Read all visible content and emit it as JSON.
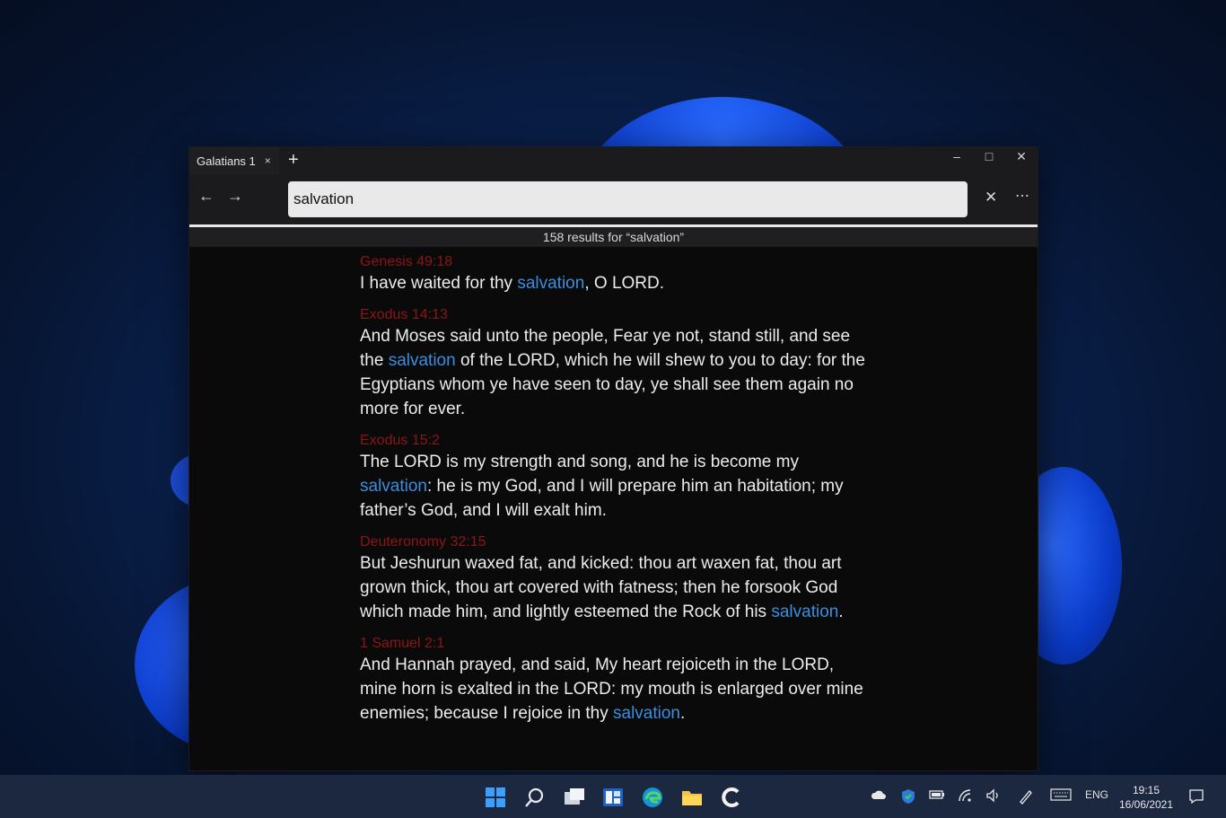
{
  "window": {
    "tab_title": "Galatians 1",
    "tab_close_glyph": "×",
    "new_tab_glyph": "+",
    "minimize_glyph": "–",
    "maximize_glyph": "□",
    "close_glyph": "✕"
  },
  "toolbar": {
    "back_glyph": "←",
    "forward_glyph": "→",
    "search_value": "salvation",
    "clear_glyph": "✕",
    "more_glyph": "⋯"
  },
  "results_summary": "158 results for “salvation”",
  "results": [
    {
      "ref": "Genesis 49:18",
      "parts": [
        "I have waited for thy ",
        "salvation",
        ", O LORD."
      ]
    },
    {
      "ref": "Exodus 14:13",
      "parts": [
        "And Moses said unto the people, Fear ye not, stand still, and see the ",
        "salvation",
        " of the LORD, which he will shew to you to day: for the Egyptians whom ye have seen to day, ye shall see them again no more for ever."
      ]
    },
    {
      "ref": "Exodus 15:2",
      "parts": [
        "The LORD is my strength and song, and he is become my ",
        "salvation",
        ": he is my God, and I will prepare him an habitation; my father’s God, and I will exalt him."
      ]
    },
    {
      "ref": "Deuteronomy 32:15",
      "parts": [
        "But Jeshurun waxed fat, and kicked: thou art waxen fat, thou art grown thick, thou art covered with fatness; then he forsook God which made him, and lightly esteemed the Rock of his ",
        "salvation",
        "."
      ]
    },
    {
      "ref": "1 Samuel 2:1",
      "parts": [
        "And Hannah prayed, and said, My heart rejoiceth in the LORD, mine horn is exalted in the LORD: my mouth is enlarged over mine enemies; because I rejoice in thy ",
        "salvation",
        "."
      ]
    }
  ],
  "taskbar": {
    "icons": [
      "windows-start-icon",
      "search-icon",
      "task-view-icon",
      "widgets-icon",
      "edge-browser-icon",
      "file-explorer-icon",
      "bible-app-icon"
    ],
    "tray": {
      "language": "ENG",
      "time": "19:15",
      "date": "16/06/2021"
    }
  },
  "colors": {
    "reference": "#8e1515",
    "highlight": "#3a8ee0",
    "text": "#ececec",
    "taskbar": "#1c2740"
  }
}
